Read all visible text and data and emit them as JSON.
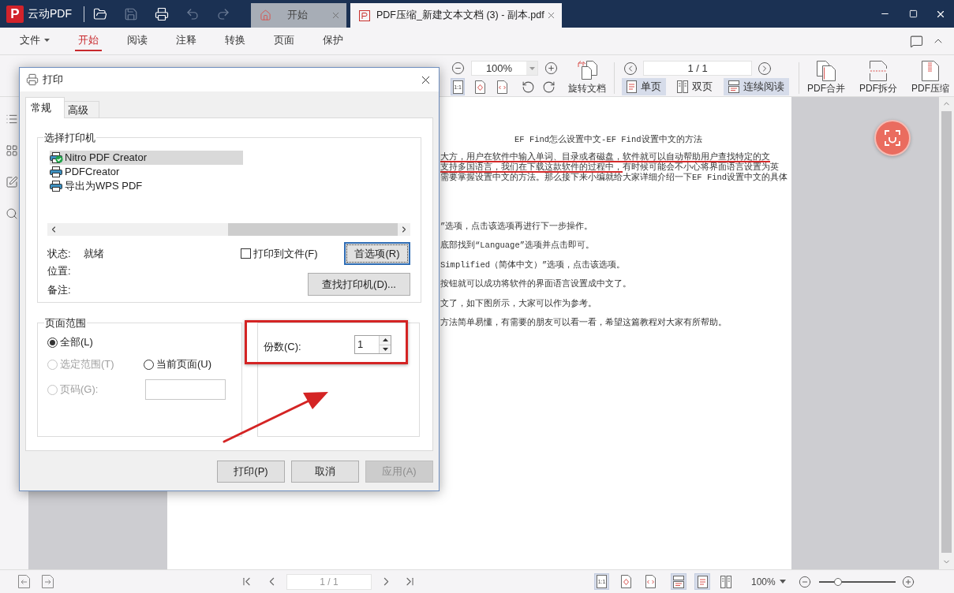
{
  "app": {
    "logo_letter": "P",
    "name": "云动PDF"
  },
  "quick_actions": [
    {
      "kind": "open",
      "disabled": false
    },
    {
      "kind": "save",
      "disabled": true
    },
    {
      "kind": "print",
      "disabled": false
    },
    {
      "kind": "undo",
      "disabled": true
    },
    {
      "kind": "redo",
      "disabled": true
    }
  ],
  "document_tabs": [
    {
      "kind": "home",
      "label": "开始",
      "selected": false
    },
    {
      "kind": "pdf",
      "label": "PDF压缩_新建文本文档 (3) - 副本.pdf",
      "selected": true
    }
  ],
  "ribbon_tabs": [
    {
      "kind": "menu",
      "label": "文件",
      "selected": false
    },
    {
      "kind": "tab",
      "label": "开始",
      "selected": true
    },
    {
      "kind": "tab",
      "label": "阅读",
      "selected": false
    },
    {
      "kind": "tab",
      "label": "注释",
      "selected": false
    },
    {
      "kind": "tab",
      "label": "转换",
      "selected": false
    },
    {
      "kind": "tab",
      "label": "页面",
      "selected": false
    },
    {
      "kind": "tab",
      "label": "保护",
      "selected": false
    }
  ],
  "toolbar": {
    "zoom_value": "100%",
    "fit_modes": [
      {
        "kind": "actual-size",
        "label": "1:1",
        "selected": true
      },
      {
        "kind": "fit-page",
        "selected": false
      },
      {
        "kind": "fit-width",
        "selected": false
      }
    ],
    "rotate_document": "旋转文档",
    "page_value": "1 / 1",
    "view_modes": [
      {
        "kind": "single",
        "label": "单页",
        "selected": true
      },
      {
        "kind": "double",
        "label": "双页",
        "selected": false
      },
      {
        "kind": "continuous",
        "label": "连续阅读",
        "selected": true
      }
    ],
    "tools": [
      {
        "kind": "merge",
        "label": "PDF合并"
      },
      {
        "kind": "split",
        "label": "PDF拆分"
      },
      {
        "kind": "compress",
        "label": "PDF压缩"
      }
    ]
  },
  "document": {
    "title": "EF Find怎么设置中文-EF Find设置中文的方法",
    "lines": [
      {
        "segments": [
          {
            "text": "大方，用户在软件中输入单词、目录或者磁盘，软件就可以自动帮助用户查找特定的文",
            "underlined": true
          }
        ]
      },
      {
        "segments": [
          {
            "text": "支持多国语言，我们在下载这款软件的过程中，",
            "underlined": true
          },
          {
            "text": "有时候可能会不小心将界面语言设置为英",
            "underlined": false
          }
        ]
      },
      {
        "segments": [
          {
            "text": "需要掌握设置中文的方法。那么接下来小编就给大家详细介绍一下EF Find设置中文的具体",
            "underlined": false
          }
        ]
      }
    ],
    "steps": [
      "”选项，点击该选项再进行下一步操作。",
      "底部找到“Language”选项并点击即可。",
      "Simplified（简体中文）”选项，点击该选项。",
      "按钮就可以成功将软件的界面语言设置成中文了。",
      "文了，如下图所示，大家可以作为参考。",
      "方法简单易懂，有需要的朋友可以看一看，希望这篇教程对大家有所帮助。"
    ]
  },
  "print_dialog": {
    "title": "打印",
    "tabs": [
      {
        "label": "常规",
        "selected": true
      },
      {
        "label": "高级",
        "selected": false
      }
    ],
    "printer_group": {
      "legend": "选择打印机",
      "printers": [
        {
          "name": "Nitro PDF Creator",
          "selected": true,
          "is_default": true
        },
        {
          "name": "PDFCreator",
          "selected": false,
          "is_default": false
        },
        {
          "name": "导出为WPS PDF",
          "selected": false,
          "is_default": false
        }
      ],
      "status_label": "状态:",
      "status_value": "就绪",
      "location_label": "位置:",
      "comment_label": "备注:",
      "print_to_file": {
        "label": "打印到文件(F)",
        "checked": false
      },
      "preferences_button": {
        "label": "首选项(R)",
        "focused": true
      },
      "find_printer_button": {
        "label": "查找打印机(D)..."
      }
    },
    "page_range": {
      "legend": "页面范围",
      "options": [
        {
          "kind": "all",
          "label": "全部(L)",
          "selected": true,
          "disabled": false
        },
        {
          "kind": "selection",
          "label": "选定范围(T)",
          "selected": false,
          "disabled": true
        },
        {
          "kind": "current",
          "label": "当前页面(U)",
          "selected": false,
          "disabled": false
        },
        {
          "kind": "pages",
          "label": "页码(G):",
          "selected": false,
          "disabled": true
        }
      ]
    },
    "copies": {
      "label": "份数(C):",
      "value": "1"
    },
    "buttons": [
      {
        "label": "打印(P)",
        "disabled": false
      },
      {
        "label": "取消",
        "disabled": false
      },
      {
        "label": "应用(A)",
        "disabled": true
      }
    ]
  },
  "status_bar": {
    "page_value": "1 / 1",
    "fit_modes": [
      {
        "kind": "actual-size",
        "label": "1:1",
        "selected": true
      },
      {
        "kind": "fit-page",
        "selected": false
      },
      {
        "kind": "fit-width",
        "selected": false
      }
    ],
    "layout_modes": [
      {
        "kind": "continuous",
        "selected": true
      },
      {
        "kind": "single",
        "selected": true
      },
      {
        "kind": "double",
        "selected": false
      }
    ],
    "zoom_value": "100%",
    "zoom_slider": {
      "level": 0.25
    }
  }
}
